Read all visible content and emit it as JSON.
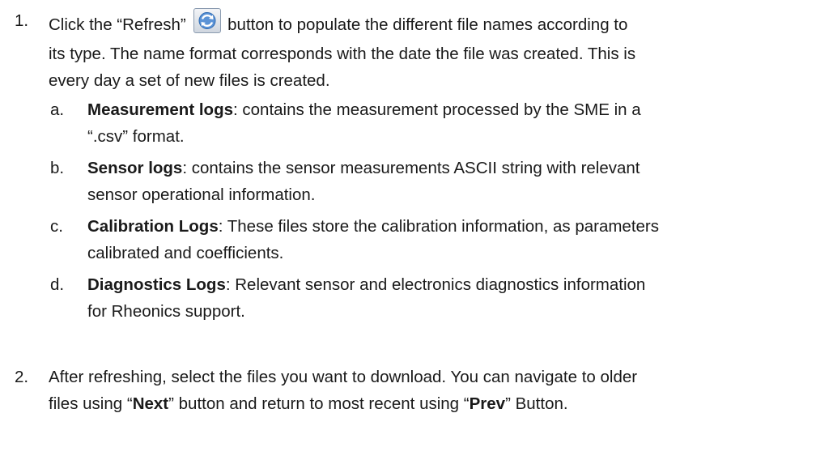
{
  "step1": {
    "number": "1.",
    "text_before_button": "Click the “Refresh”",
    "text_after_button": "button to populate the different file names according to",
    "line2": "its type. The name format corresponds with the date the file was created. This is",
    "line3": "every day a set of new files is created.",
    "refresh_icon": "refresh-icon",
    "subitems": [
      {
        "letter": "a.",
        "term": "Measurement logs",
        "line1_rest": ": contains the measurement processed by the SME in a",
        "line2": "“.csv” format."
      },
      {
        "letter": "b.",
        "term": "Sensor logs",
        "line1_rest": ": contains the sensor measurements ASCII string with relevant",
        "line2": "sensor operational information."
      },
      {
        "letter": "c.",
        "term": "Calibration Logs",
        "line1_rest": ": These files store the calibration information, as parameters",
        "line2": "calibrated and coefficients."
      },
      {
        "letter": "d.",
        "term": "Diagnostics Logs",
        "line1_rest": ": Relevant sensor and electronics diagnostics information",
        "line2": "for Rheonics support."
      }
    ]
  },
  "step2": {
    "number": "2.",
    "line1": "After refreshing, select the files you want to download. You can navigate to older",
    "line2_a": "files using “",
    "next_label": "Next",
    "line2_b": "” button and return to most recent using “",
    "prev_label": "Prev",
    "line2_c": "” Button."
  }
}
